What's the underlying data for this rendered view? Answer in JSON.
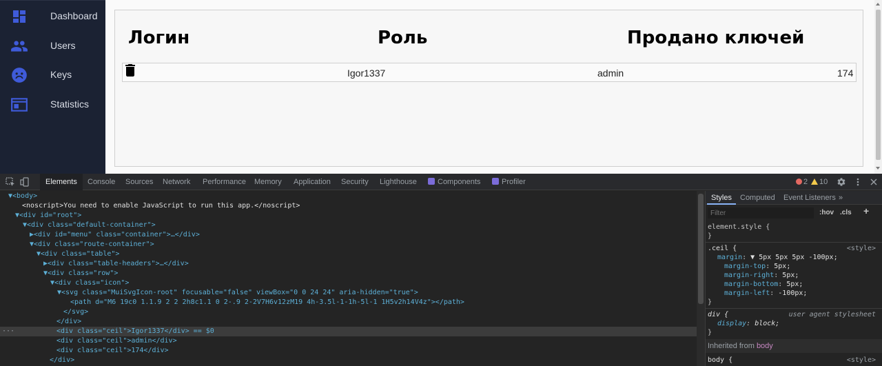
{
  "sidebar": {
    "items": [
      {
        "label": "Dashboard",
        "icon": "dashboard-icon"
      },
      {
        "label": "Users",
        "icon": "users-icon"
      },
      {
        "label": "Keys",
        "icon": "keys-icon"
      },
      {
        "label": "Statistics",
        "icon": "statistics-icon"
      }
    ]
  },
  "table": {
    "headers": [
      "Логин",
      "Роль",
      "Продано ключей"
    ],
    "rows": [
      {
        "login": "Igor1337",
        "role": "admin",
        "sold": "174",
        "action_icon": "trash-icon"
      }
    ]
  },
  "devtools": {
    "tabs": [
      "Elements",
      "Console",
      "Sources",
      "Network",
      "Performance",
      "Memory",
      "Application",
      "Security",
      "Lighthouse",
      "Components",
      "Profiler"
    ],
    "active_tab": "Elements",
    "errors": "2",
    "warnings": "10",
    "dom_lines": [
      "▼<body>",
      "<noscript>You need to enable JavaScript to run this app.</noscript>",
      "▼<div id=\"root\">",
      "▼<div class=\"default-container\">",
      "▶<div id=\"menu\" class=\"container\">…</div>",
      "▼<div class=\"route-container\">",
      "▼<div class=\"table\">",
      "▶<div class=\"table-headers\">…</div>",
      "▼<div class=\"row\">",
      "▼<div class=\"icon\">",
      "▼<svg class=\"MuiSvgIcon-root\" focusable=\"false\" viewBox=\"0 0 24 24\" aria-hidden=\"true\">",
      "<path d=\"M6 19c0 1.1.9 2 2 2h8c1.1 0 2-.9 2-2V7H6v12zM19 4h-3.5l-1-1h-5l-1 1H5v2h14V4z\"></path>",
      "</svg>",
      "</div>",
      "<div class=\"ceil\">Igor1337</div> == $0",
      "<div class=\"ceil\">admin</div>",
      "<div class=\"ceil\">174</div>",
      "</div>"
    ],
    "styles": {
      "tabs": [
        "Styles",
        "Computed",
        "Event Listeners",
        "»"
      ],
      "filter_placeholder": "Filter",
      "hov": ":hov",
      "cls": ".cls",
      "add": "+",
      "element_style": "element.style {",
      "close": "}",
      "rule_selector": ".ceil {",
      "rule_source": "<style>",
      "margin_name": "margin",
      "margin_value": "▼ 5px 5px 5px -100px;",
      "props": [
        {
          "name": "margin-top",
          "value": "5px;"
        },
        {
          "name": "margin-right",
          "value": "5px;"
        },
        {
          "name": "margin-bottom",
          "value": "5px;"
        },
        {
          "name": "margin-left",
          "value": "-100px;"
        }
      ],
      "div_selector": "div {",
      "div_source": "user agent stylesheet",
      "display_name": "display",
      "display_value": "block;",
      "inherited_label": "Inherited from",
      "inherited_from": "body",
      "body_selector": "body {",
      "body_source": "<style>"
    }
  }
}
